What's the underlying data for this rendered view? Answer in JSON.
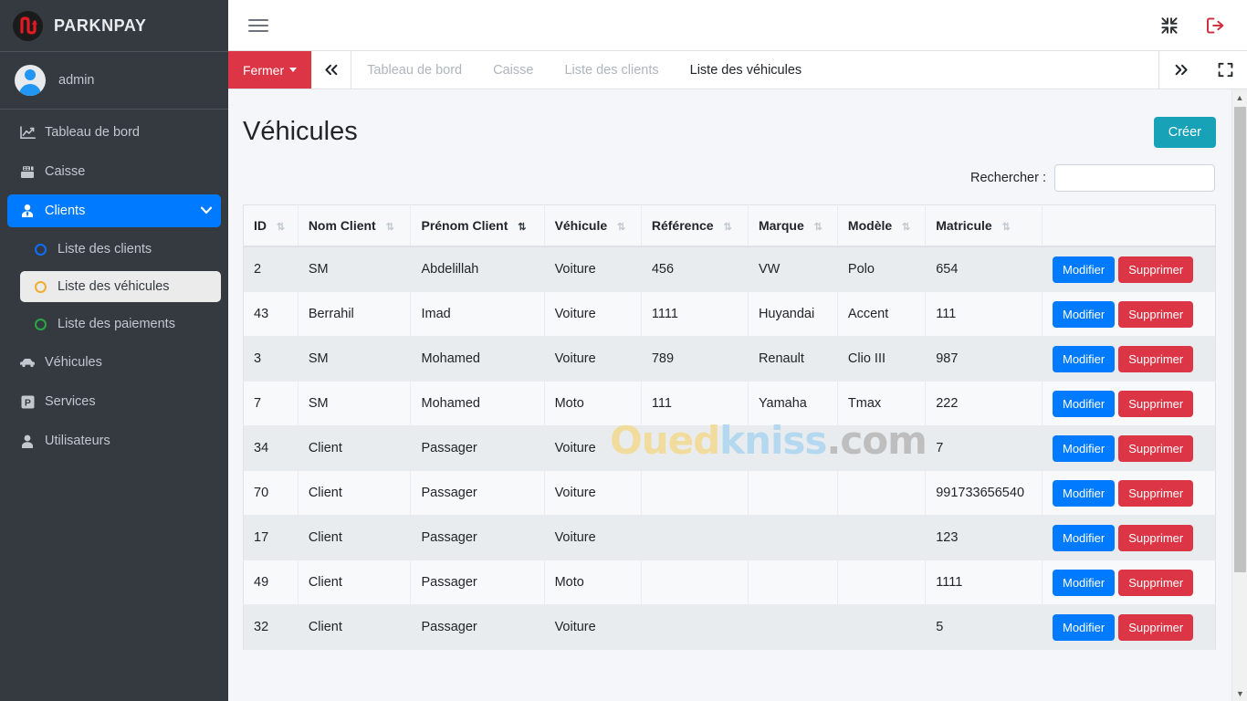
{
  "brand": {
    "name": "PARKNPAY",
    "logo_icon": "parknpay-logo-icon"
  },
  "user": {
    "name": "admin",
    "avatar_icon": "user-avatar-icon"
  },
  "sidebar": {
    "items": [
      {
        "label": "Tableau de bord",
        "icon": "chart-line-icon",
        "state": "normal"
      },
      {
        "label": "Caisse",
        "icon": "cash-register-icon",
        "state": "normal"
      },
      {
        "label": "Clients",
        "icon": "user-tie-icon",
        "state": "active-blue",
        "chevron": "chevron-down-icon"
      },
      {
        "label": "Liste des clients",
        "icon": "circle-icon",
        "state": "sub",
        "dot_color": "#0d6efd"
      },
      {
        "label": "Liste des véhicules",
        "icon": "circle-icon",
        "state": "sub-active",
        "dot_color": "#f0ad2e"
      },
      {
        "label": "Liste des paiements",
        "icon": "circle-icon",
        "state": "sub",
        "dot_color": "#28a745"
      },
      {
        "label": "Véhicules",
        "icon": "car-icon",
        "state": "normal"
      },
      {
        "label": "Services",
        "icon": "parking-p-icon",
        "state": "normal"
      },
      {
        "label": "Utilisateurs",
        "icon": "user-icon",
        "state": "normal"
      }
    ]
  },
  "topbar": {
    "menu_icon": "hamburger-menu-icon",
    "compress_icon": "compress-icon",
    "logout_icon": "logout-icon"
  },
  "tabbar": {
    "close_label": "Fermer",
    "prev_icon": "chevrons-left-icon",
    "next_icon": "chevrons-right-icon",
    "fullscreen_icon": "expand-icon",
    "tabs": [
      {
        "label": "Tableau de bord",
        "active": false
      },
      {
        "label": "Caisse",
        "active": false
      },
      {
        "label": "Liste des clients",
        "active": false
      },
      {
        "label": "Liste des véhicules",
        "active": true
      }
    ]
  },
  "page": {
    "title": "Véhicules",
    "create_label": "Créer",
    "search_label": "Rechercher :",
    "search_value": "",
    "search_placeholder": ""
  },
  "table": {
    "columns": [
      {
        "label": "ID",
        "sort": "none"
      },
      {
        "label": "Nom Client",
        "sort": "none"
      },
      {
        "label": "Prénom Client",
        "sort": "asc"
      },
      {
        "label": "Véhicule",
        "sort": "none"
      },
      {
        "label": "Référence",
        "sort": "none"
      },
      {
        "label": "Marque",
        "sort": "none"
      },
      {
        "label": "Modèle",
        "sort": "none"
      },
      {
        "label": "Matricule",
        "sort": "none"
      },
      {
        "label": "",
        "sort": "none"
      }
    ],
    "edit_label": "Modifier",
    "delete_label": "Supprimer",
    "rows": [
      {
        "id": "2",
        "nom": "SM",
        "prenom": "Abdelillah",
        "vehicule": "Voiture",
        "reference": "456",
        "marque": "VW",
        "modele": "Polo",
        "matricule": "654"
      },
      {
        "id": "43",
        "nom": "Berrahil",
        "prenom": "Imad",
        "vehicule": "Voiture",
        "reference": "1111",
        "marque": "Huyandai",
        "modele": "Accent",
        "matricule": "111"
      },
      {
        "id": "3",
        "nom": "SM",
        "prenom": "Mohamed",
        "vehicule": "Voiture",
        "reference": "789",
        "marque": "Renault",
        "modele": "Clio III",
        "matricule": "987"
      },
      {
        "id": "7",
        "nom": "SM",
        "prenom": "Mohamed",
        "vehicule": "Moto",
        "reference": "111",
        "marque": "Yamaha",
        "modele": "Tmax",
        "matricule": "222"
      },
      {
        "id": "34",
        "nom": "Client",
        "prenom": "Passager",
        "vehicule": "Voiture",
        "reference": "",
        "marque": "",
        "modele": "",
        "matricule": "7"
      },
      {
        "id": "70",
        "nom": "Client",
        "prenom": "Passager",
        "vehicule": "Voiture",
        "reference": "",
        "marque": "",
        "modele": "",
        "matricule": "991733656540"
      },
      {
        "id": "17",
        "nom": "Client",
        "prenom": "Passager",
        "vehicule": "Voiture",
        "reference": "",
        "marque": "",
        "modele": "",
        "matricule": "123"
      },
      {
        "id": "49",
        "nom": "Client",
        "prenom": "Passager",
        "vehicule": "Moto",
        "reference": "",
        "marque": "",
        "modele": "",
        "matricule": "1111"
      },
      {
        "id": "32",
        "nom": "Client",
        "prenom": "Passager",
        "vehicule": "Voiture",
        "reference": "",
        "marque": "",
        "modele": "",
        "matricule": "5"
      }
    ]
  },
  "watermark": {
    "part1": "Oued",
    "part2": "kniss",
    "part3": ".com"
  },
  "colors": {
    "sidebar_bg": "#343a40",
    "accent_blue": "#007bff",
    "danger_red": "#dc3545",
    "create_teal": "#17a2b8",
    "sub_active_bg": "#ebebeb"
  }
}
